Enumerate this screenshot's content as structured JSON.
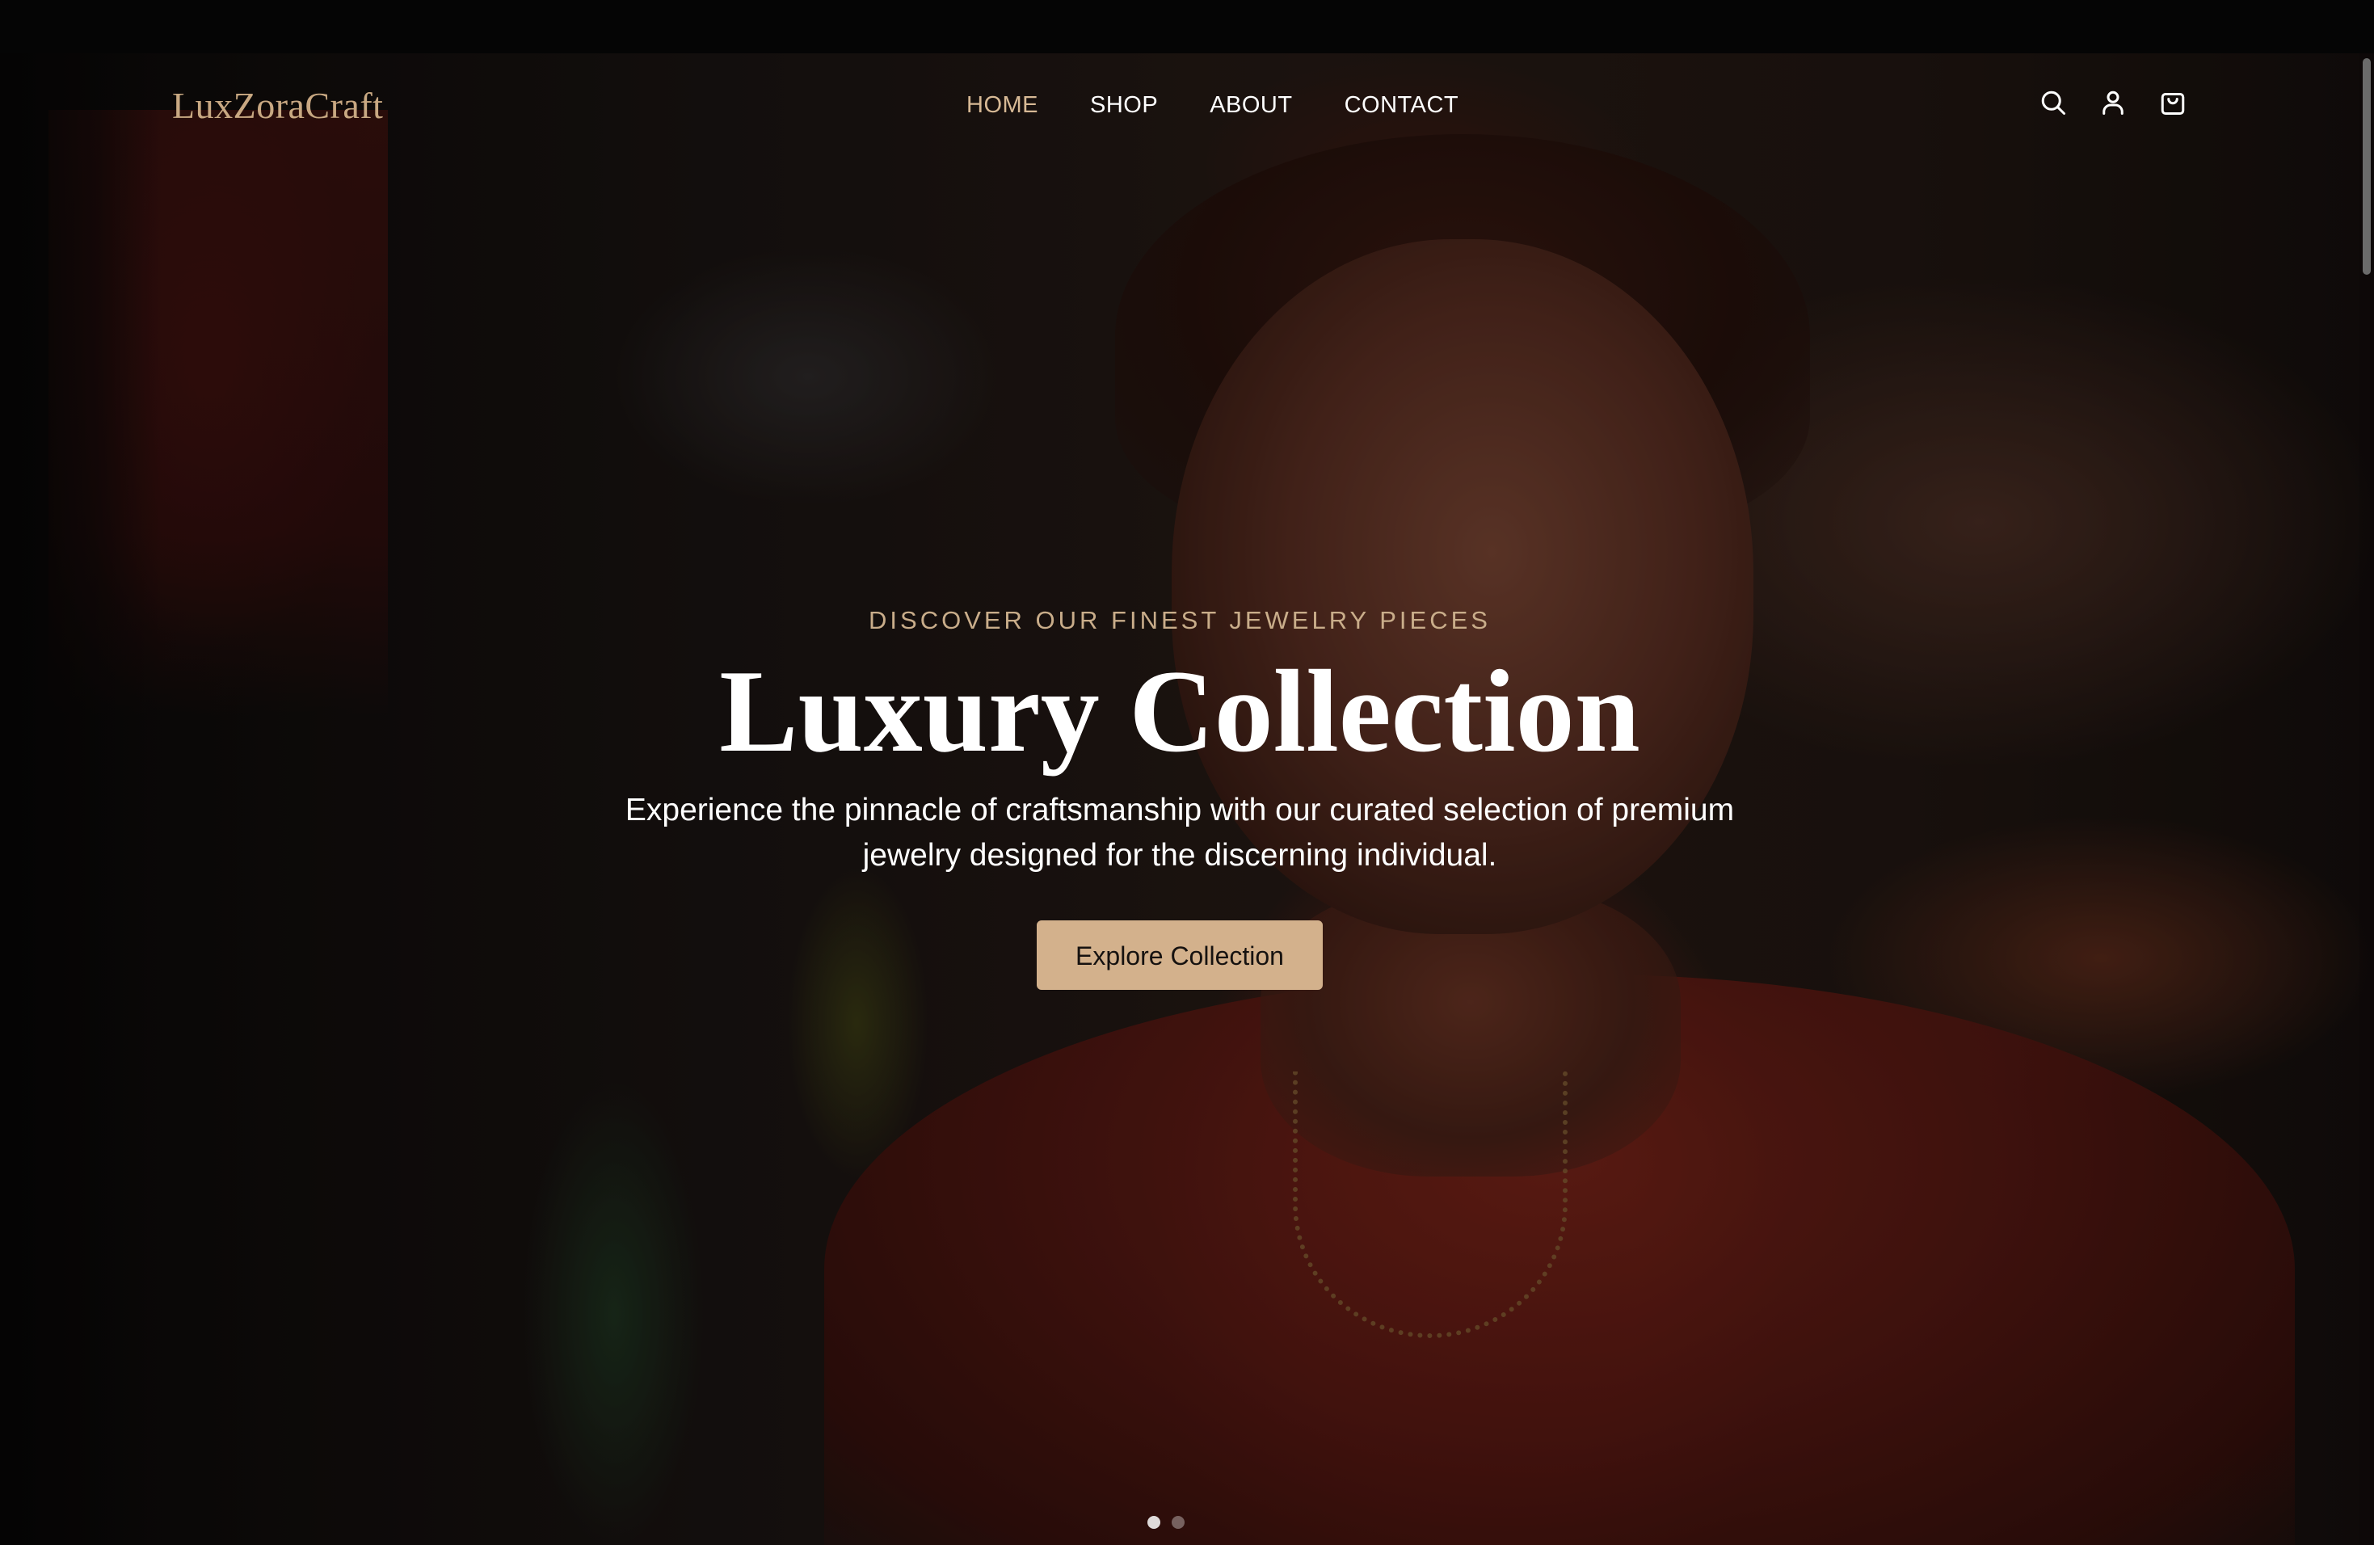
{
  "brand": {
    "logo_text": "LuxZoraCraft"
  },
  "nav": {
    "links": [
      {
        "label": "HOME",
        "active": true
      },
      {
        "label": "SHOP",
        "active": false
      },
      {
        "label": "ABOUT",
        "active": false
      },
      {
        "label": "CONTACT",
        "active": false
      }
    ],
    "icons": [
      "search-icon",
      "user-icon",
      "shopping-bag-icon"
    ]
  },
  "hero": {
    "eyebrow": "DISCOVER OUR FINEST JEWELRY PIECES",
    "title": "Luxury Collection",
    "description": "Experience the pinnacle of craftsmanship with our curated selection of premium jewelry designed for the discerning individual.",
    "cta_label": "Explore Collection",
    "slides_count": 2,
    "active_slide": 1
  },
  "colors": {
    "accent": "#d3b18c",
    "logo": "#c8a882",
    "nav_active": "#d7b995",
    "eyebrow": "#c9ad8a",
    "text": "#ffffff"
  }
}
